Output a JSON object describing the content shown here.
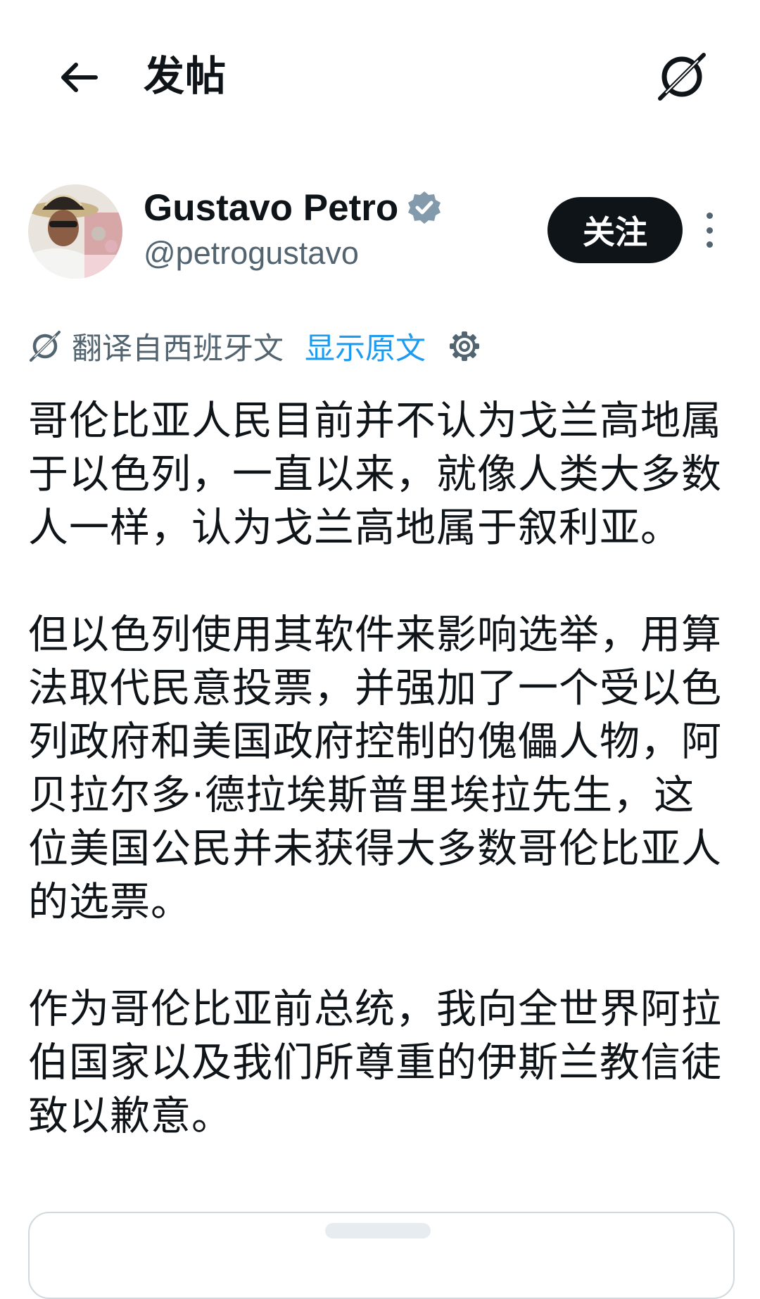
{
  "header": {
    "title": "发帖"
  },
  "author": {
    "display_name": "Gustavo Petro",
    "handle": "@petrogustavo",
    "follow_label": "关注"
  },
  "translation": {
    "label": "翻译自西班牙文",
    "show_original": "显示原文"
  },
  "tweet": {
    "paragraphs": [
      "哥伦比亚人民目前并不认为戈兰高地属于以色列，一直以来，就像人类大多数人一样，认为戈兰高地属于叙利亚。",
      "但以色列使用其软件来影响选举，用算法取代民意投票，并强加了一个受以色列政府和美国政府控制的傀儡人物，阿贝拉尔多·德拉埃斯普里埃拉先生，这位美国公民并未获得大多数哥伦比亚人的选票。",
      "作为哥伦比亚前总统，我向全世界阿拉伯国家以及我们所尊重的伊斯兰教信徒致以歉意。"
    ]
  },
  "icons": {
    "back": "arrow-left-icon",
    "grok": "grok-icon",
    "verified": "verified-badge-icon",
    "more": "more-vertical-icon",
    "translate": "grok-translate-icon",
    "settings": "gear-icon"
  },
  "colors": {
    "text_primary": "#0f1419",
    "text_secondary": "#536471",
    "link": "#1d9bf0",
    "follow_bg": "#0f1419",
    "verified_badge": "#829aab"
  }
}
